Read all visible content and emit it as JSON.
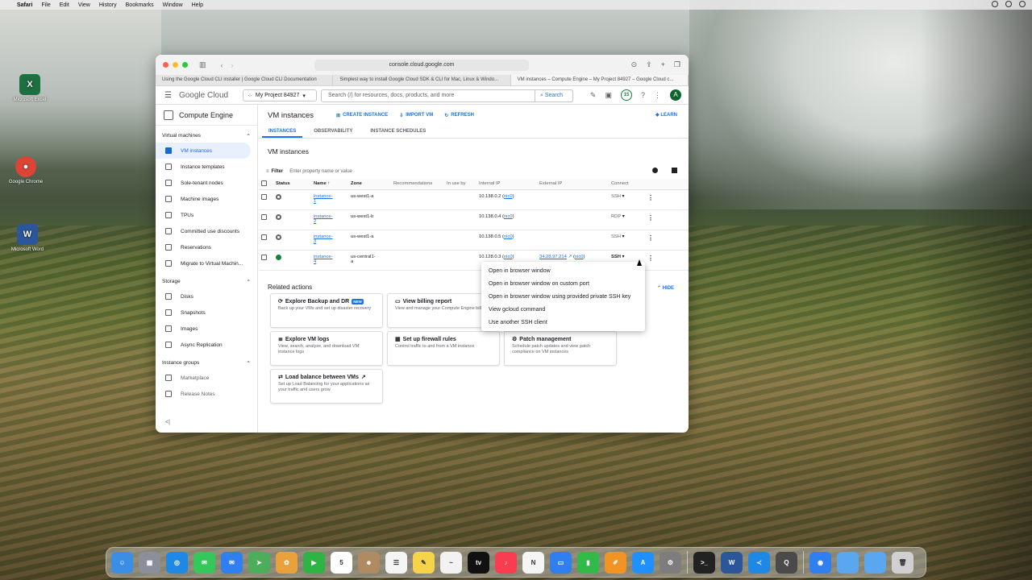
{
  "menubar": {
    "app": "Safari",
    "items": [
      "File",
      "Edit",
      "View",
      "History",
      "Bookmarks",
      "Window",
      "Help"
    ]
  },
  "desktop": {
    "icons": [
      {
        "label": "Microsoft Excel",
        "glyph": "X",
        "color": "#1d6f42"
      },
      {
        "label": "Google Chrome",
        "glyph": "●",
        "color": "#db4437"
      },
      {
        "label": "Microsoft Word",
        "glyph": "W",
        "color": "#2b579a"
      }
    ]
  },
  "browser": {
    "url": "console.cloud.google.com",
    "tabs": [
      "Using the Google Cloud CLI installer | Google Cloud CLI Documentation",
      "Simplest way to install Google Cloud SDK & CLI for Mac, Linux & Windo...",
      "VM instances – Compute Engine – My Project 84927 – Google Cloud c..."
    ]
  },
  "gcp": {
    "logo": "Google Cloud",
    "project": "My Project 84927",
    "search_placeholder": "Search (/) for resources, docs, products, and more",
    "search_button": "Search",
    "notif_count": "15",
    "avatar": "A"
  },
  "sidebar": {
    "title": "Compute Engine",
    "groups": {
      "vm": "Virtual machines",
      "storage": "Storage",
      "instance_groups": "Instance groups"
    },
    "vm_items": [
      "VM instances",
      "Instance templates",
      "Sole-tenant nodes",
      "Machine images",
      "TPUs",
      "Committed use discounts",
      "Reservations",
      "Migrate to Virtual Machin..."
    ],
    "storage_items": [
      "Disks",
      "Snapshots",
      "Images",
      "Async Replication"
    ],
    "bottom_items": [
      "Marketplace",
      "Release Notes"
    ]
  },
  "toolbar": {
    "title": "VM instances",
    "create": "CREATE INSTANCE",
    "import": "IMPORT VM",
    "refresh": "REFRESH",
    "learn": "LEARN"
  },
  "subtabs": [
    "INSTANCES",
    "OBSERVABILITY",
    "INSTANCE SCHEDULES"
  ],
  "section_title": "VM instances",
  "filter": {
    "label": "Filter",
    "placeholder": "Enter property name or value"
  },
  "table": {
    "headers": [
      "Status",
      "Name",
      "Zone",
      "Recommendations",
      "In use by",
      "Internal IP",
      "External IP",
      "Connect"
    ],
    "rows": [
      {
        "name1": "instance-",
        "name2": "1",
        "zone1": "us-west1-a",
        "zone2": "",
        "ip": "10.138.0.2",
        "nic": "nic0",
        "ext": "",
        "ext_nic": "",
        "connect": "SSH",
        "status": "stopped"
      },
      {
        "name1": "instance-",
        "name2": "2",
        "zone1": "us-west1-b",
        "zone2": "",
        "ip": "10.138.0.4",
        "nic": "nic0",
        "ext": "",
        "ext_nic": "",
        "connect": "RDP",
        "status": "stopped"
      },
      {
        "name1": "instance-",
        "name2": "3",
        "zone1": "us-west1-a",
        "zone2": "",
        "ip": "10.138.0.5",
        "nic": "nic0",
        "ext": "",
        "ext_nic": "",
        "connect": "SSH",
        "status": "stopped"
      },
      {
        "name1": "instance-",
        "name2": "4",
        "zone1": "us-central1-",
        "zone2": "a",
        "ip": "10.128.0.3",
        "nic": "nic0",
        "ext": "34.28.97.214",
        "ext_nic": "nic0",
        "connect": "SSH",
        "status": "running"
      }
    ]
  },
  "related": {
    "title": "Related actions",
    "hide": "HIDE",
    "cards": [
      {
        "title": "Explore Backup and DR",
        "badge": "NEW",
        "desc": "Back up your VMs and set up disaster recovery"
      },
      {
        "title": "View billing report",
        "badge": "",
        "desc": "View and manage your Compute Engine billing"
      },
      {
        "title": "Explore VM logs",
        "badge": "",
        "desc": "View, search, analyze, and download VM instance logs"
      },
      {
        "title": "Set up firewall rules",
        "badge": "",
        "desc": "Control traffic to and from a VM instance"
      },
      {
        "title": "Patch management",
        "badge": "",
        "desc": "Schedule patch updates and view patch compliance on VM instances"
      },
      {
        "title": "Load balance between VMs",
        "badge": "",
        "desc": "Set up Load Balancing for your applications as your traffic and users grow"
      }
    ]
  },
  "ssh_menu": [
    "Open in browser window",
    "Open in browser window on custom port",
    "Open in browser window using provided private SSH key",
    "View gcloud command",
    "Use another SSH client"
  ],
  "dock": {
    "apps": [
      {
        "name": "finder",
        "glyph": "☺",
        "color": "#3a8ee6"
      },
      {
        "name": "launchpad",
        "glyph": "▦",
        "color": "#8a8f99"
      },
      {
        "name": "safari",
        "glyph": "◎",
        "color": "#1e88e5"
      },
      {
        "name": "messages",
        "glyph": "✉",
        "color": "#34c759"
      },
      {
        "name": "mail",
        "glyph": "✉",
        "color": "#2f7ff0"
      },
      {
        "name": "maps",
        "glyph": "➤",
        "color": "#4cae5a"
      },
      {
        "name": "photos",
        "glyph": "✿",
        "color": "#e9a23b"
      },
      {
        "name": "facetime",
        "glyph": "▶",
        "color": "#2fb344"
      },
      {
        "name": "calendar",
        "glyph": "5",
        "color": "#ffffff"
      },
      {
        "name": "contacts",
        "glyph": "☻",
        "color": "#b08a62"
      },
      {
        "name": "reminders",
        "glyph": "☰",
        "color": "#f5f5f5"
      },
      {
        "name": "notes",
        "glyph": "✎",
        "color": "#f7d34a"
      },
      {
        "name": "freeform",
        "glyph": "~",
        "color": "#f2f2f2"
      },
      {
        "name": "tv",
        "glyph": "tv",
        "color": "#111111"
      },
      {
        "name": "music",
        "glyph": "♪",
        "color": "#fa3c50"
      },
      {
        "name": "news",
        "glyph": "N",
        "color": "#f5f5f5"
      },
      {
        "name": "keynote",
        "glyph": "▭",
        "color": "#2f7ff0"
      },
      {
        "name": "numbers",
        "glyph": "▮",
        "color": "#31b94a"
      },
      {
        "name": "pages",
        "glyph": "✐",
        "color": "#f29423"
      },
      {
        "name": "app-store",
        "glyph": "A",
        "color": "#1e90ff"
      },
      {
        "name": "system-settings",
        "glyph": "⚙",
        "color": "#7d7d7d"
      },
      {
        "name": "terminal",
        "glyph": ">_",
        "color": "#222222"
      },
      {
        "name": "word",
        "glyph": "W",
        "color": "#2b579a"
      },
      {
        "name": "vscode",
        "glyph": "≺",
        "color": "#1e88e5"
      },
      {
        "name": "quicktime",
        "glyph": "Q",
        "color": "#4a4a4a"
      },
      {
        "name": "network",
        "glyph": "◉",
        "color": "#2f7ff0"
      },
      {
        "name": "folder",
        "glyph": "",
        "color": "#5aa7f0"
      },
      {
        "name": "downloads",
        "glyph": "",
        "color": "#5aa7f0"
      },
      {
        "name": "trash",
        "glyph": "🗑",
        "color": "#d0d0d0"
      }
    ],
    "calendar_month": "JAN",
    "calendar_day": "5"
  }
}
